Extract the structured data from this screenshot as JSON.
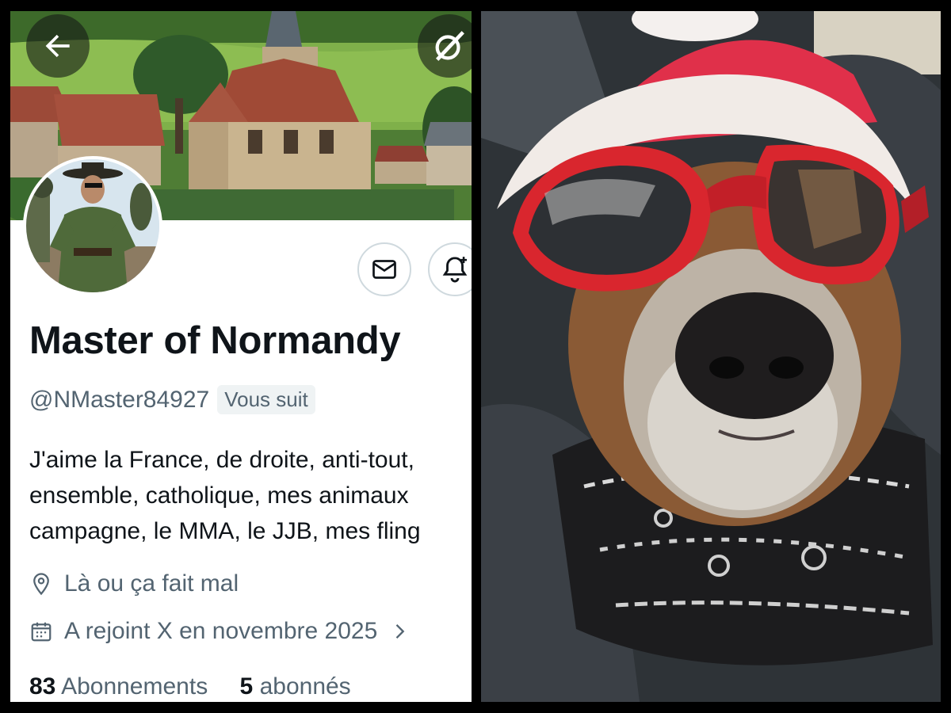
{
  "profile": {
    "display_name": "Master of Normandy",
    "handle": "@NMaster84927",
    "follows_you_badge": "Vous suit",
    "bio_lines": [
      "J'aime la France, de droite, anti-tout,",
      "ensemble, catholique, mes animaux",
      "campagne, le MMA, le JJB, mes fling"
    ],
    "location": "Là ou ça fait mal",
    "joined": "A rejoint X en novembre 2025",
    "following_count": "83",
    "following_label": "Abonnements",
    "followers_count": "5",
    "followers_label": "abonnés"
  },
  "icons": {
    "back": "arrow-left-icon",
    "grok": "grok-icon",
    "message": "envelope-icon",
    "notify": "bell-plus-icon",
    "location": "map-pin-icon",
    "joined": "calendar-icon",
    "chevron": "chevron-right-icon"
  },
  "colors": {
    "text_primary": "#0f1419",
    "text_secondary": "#536471",
    "badge_bg": "#eff3f4",
    "goggles": "#d9262e",
    "hat_red": "#e0304a"
  },
  "photo": {
    "subject": "dog wearing red goggles, Santa hat and bandana"
  }
}
